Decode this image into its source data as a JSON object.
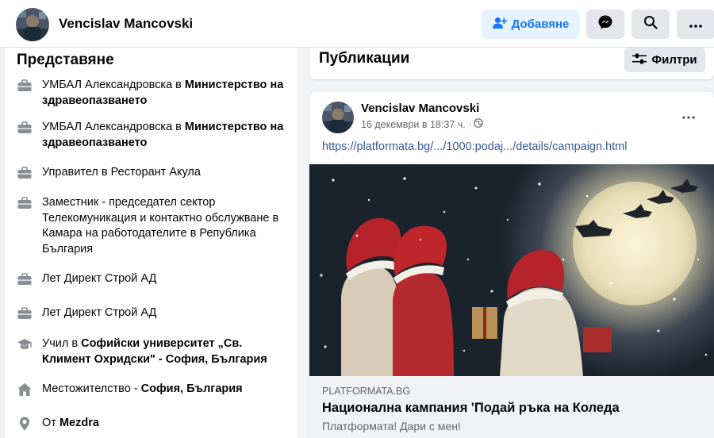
{
  "header": {
    "profile_name": "Vencislav Mancovski",
    "add_label": "Добавяне",
    "icons": [
      "person-add-icon",
      "messenger-icon",
      "search-icon",
      "more-icon"
    ]
  },
  "intro": {
    "title": "Представяне",
    "items": [
      {
        "icon": "briefcase-icon",
        "text": "УМБАЛ Александровска в ",
        "bold": "Министерство на здравеопазването"
      },
      {
        "icon": "briefcase-icon",
        "text": "УМБАЛ Александровска в ",
        "bold": "Министерство на здравеопазването"
      },
      {
        "icon": "briefcase-icon",
        "text": "Управител в Ресторант Акула",
        "bold": ""
      },
      {
        "icon": "briefcase-icon",
        "text": "Заместник - председател сектор Телекомуникация и контактно обслужване в Камара на работодателите в Република България",
        "bold": ""
      },
      {
        "icon": "briefcase-icon",
        "text": "Лет Директ Строй АД",
        "bold": ""
      },
      {
        "icon": "briefcase-icon",
        "text": "Лет Директ Строй АД",
        "bold": ""
      },
      {
        "icon": "graduation-cap-icon",
        "text": "Учил в ",
        "bold": "Софийски университет „Св. Климент Охридски\" - София, България"
      },
      {
        "icon": "home-icon",
        "text": "Местожителство - ",
        "bold": "София, България"
      },
      {
        "icon": "location-pin-icon",
        "text": "От ",
        "bold": "Mezdra"
      }
    ]
  },
  "posts": {
    "title": "Публикации",
    "filter_label": "Филтри"
  },
  "post": {
    "author": "Vencislav Mancovski",
    "time": "16 декември в 18:37 ч. ·",
    "link": "https://platformata.bg/.../1000:podaj.../details/campaign.html",
    "preview": {
      "domain": "PLATFORMATA.BG",
      "title": "Национална кампания 'Подай ръка на Коледа",
      "subtitle": "Платформата! Дари с мен!"
    }
  },
  "colors": {
    "accent": "#1877f2",
    "accent_bg": "#e7f3ff",
    "button_bg": "#e4e6eb",
    "page_bg": "#f0f2f5",
    "muted_text": "#65676b",
    "link": "#385898"
  }
}
